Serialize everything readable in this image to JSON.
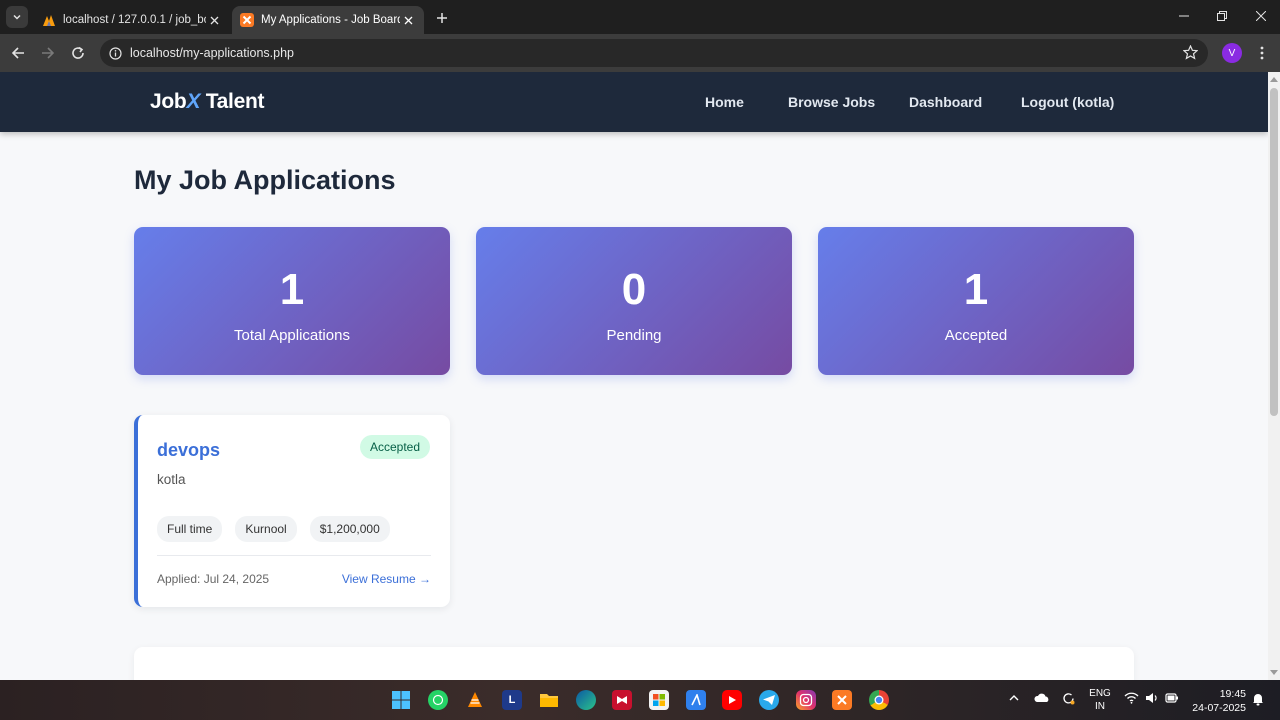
{
  "browser": {
    "tabs": [
      {
        "title": "localhost / 127.0.0.1 / job_board",
        "active": false
      },
      {
        "title": "My Applications - Job Board Po",
        "active": true
      }
    ],
    "url": "localhost/my-applications.php",
    "profile_initial": "V"
  },
  "site": {
    "logo_pre": "Job",
    "logo_x": "X",
    "logo_post": " Talent",
    "nav": [
      "Home",
      "Browse Jobs",
      "Dashboard",
      "Logout (kotla)"
    ]
  },
  "page": {
    "title": "My Job Applications",
    "stats": [
      {
        "value": "1",
        "label": "Total Applications"
      },
      {
        "value": "0",
        "label": "Pending"
      },
      {
        "value": "1",
        "label": "Accepted"
      }
    ],
    "applications": [
      {
        "job_title": "devops",
        "status": "Accepted",
        "company": "kotla",
        "tags": [
          "Full time",
          "Kurnool",
          "$1,200,000"
        ],
        "applied": "Applied: Jul 24, 2025",
        "resume_link": "View Resume →"
      }
    ]
  },
  "taskbar": {
    "lang_line1": "ENG",
    "lang_line2": "IN",
    "time": "19:45",
    "date": "24-07-2025"
  }
}
